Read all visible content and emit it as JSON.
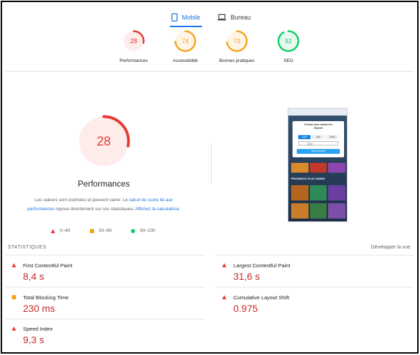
{
  "tabs": {
    "mobile": "Mobile",
    "desktop": "Bureau",
    "active": "mobile"
  },
  "categories": [
    {
      "id": "performances",
      "score": "28",
      "label": "Performances",
      "value": 28,
      "color": "#e53935",
      "fill": "#fdecea"
    },
    {
      "id": "accessibilite",
      "score": "74",
      "label": "Accessibilité",
      "value": 74,
      "color": "#f4a51c",
      "fill": "#fff5e6"
    },
    {
      "id": "bonnes-pratiques",
      "score": "73",
      "label": "Bonnes pratiques",
      "value": 73,
      "color": "#f4a51c",
      "fill": "#fff5e6"
    },
    {
      "id": "seo",
      "score": "92",
      "label": "SEO",
      "value": 92,
      "color": "#0cce6b",
      "fill": "#e8faf0"
    }
  ],
  "main_gauge": {
    "score": "28",
    "value": 28,
    "title": "Performances",
    "color": "#e53935",
    "fill": "#fdecea"
  },
  "description": {
    "text1": "Les valeurs sont estimées et peuvent varier. Le ",
    "link1": "calcul du score lié aux performances",
    "text2": " repose directement sur ces statistiques. ",
    "link2": "Affichez la calculatrice",
    "text3": "."
  },
  "legend": [
    {
      "shape": "triangle",
      "label": "0–49",
      "color": "#e53935"
    },
    {
      "shape": "square",
      "label": "50–89",
      "color": "#f4a51c"
    },
    {
      "shape": "circle",
      "label": "90–100",
      "color": "#0cce6b"
    }
  ],
  "screenshot": {
    "modal_title_1": "Choose your amount to",
    "modal_title_2": "deposit",
    "amounts": [
      "100",
      "500",
      "1000"
    ],
    "select_value": "10.00",
    "button": "Quick deposit",
    "games_heading": "PRAGMATIC PLAY GAMES"
  },
  "stats": {
    "heading": "STATISTIQUES",
    "expand": "Développer la vue",
    "metrics": [
      {
        "label": "First Contentful Paint",
        "value": "8,4 s",
        "status": "fail"
      },
      {
        "label": "Largest Contentful Paint",
        "value": "31,6 s",
        "status": "fail"
      },
      {
        "label": "Total Blocking Time",
        "value": "230 ms",
        "status": "average"
      },
      {
        "label": "Cumulative Layout Shift",
        "value": "0.975",
        "status": "fail"
      },
      {
        "label": "Speed Index",
        "value": "9,3 s",
        "status": "fail"
      }
    ]
  }
}
